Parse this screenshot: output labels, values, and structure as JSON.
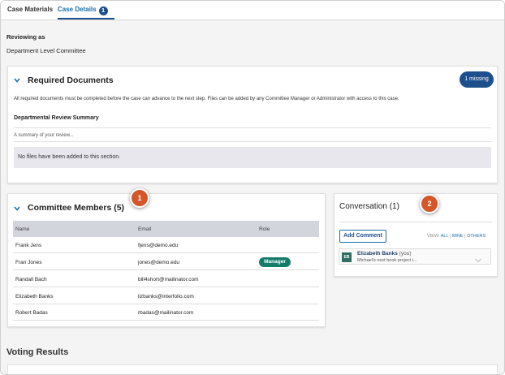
{
  "tabs": [
    {
      "label": "Case Materials",
      "active": false
    },
    {
      "label": "Case Details",
      "active": true,
      "badge": "1"
    }
  ],
  "reviewing": {
    "label": "Reviewing as",
    "value": "Department Level Committee"
  },
  "required_documents": {
    "title": "Required Documents",
    "missing_label": "1 missing",
    "description": "All required documents must be completed before the case can advance to the next step. Files can be added by any Committee Manager or Administrator with access to this case.",
    "section_title": "Departmental Review Summary",
    "summary_placeholder": "A summary of your review...",
    "empty_message": "No files have been added to this section."
  },
  "committee": {
    "title": "Committee Members (5)",
    "columns": [
      "Name",
      "Email",
      "Role"
    ],
    "rows": [
      {
        "name": "Frank Jens",
        "email": "fjens@demo.edu",
        "role": ""
      },
      {
        "name": "Fran Jones",
        "email": "jones@demo.edu",
        "role": "Manager"
      },
      {
        "name": "Randall Bach",
        "email": "bill4short@mailinator.com",
        "role": ""
      },
      {
        "name": "Elizabeth Banks",
        "email": "lizbanks@interfolio.com",
        "role": ""
      },
      {
        "name": "Robert Badas",
        "email": "rbadas@mailinator.com",
        "role": ""
      }
    ]
  },
  "conversation": {
    "title": "Conversation (1)",
    "add_comment": "Add Comment",
    "view_label": "VIEW:",
    "view_all": "ALL",
    "view_mine": "MINE",
    "view_others": "OTHERS",
    "separator": "|",
    "comment": {
      "initials": "EB",
      "author": "Elizabeth Banks",
      "you": "(you)",
      "snippet": "Michael's next book project i..."
    }
  },
  "markers": [
    "1",
    "2"
  ],
  "voting": {
    "title": "Voting Results"
  },
  "colors": {
    "brand_blue": "#1c4f8c",
    "link_blue": "#1c6fa8",
    "manager_green": "#157c6a",
    "marker_orange": "#d45629"
  }
}
